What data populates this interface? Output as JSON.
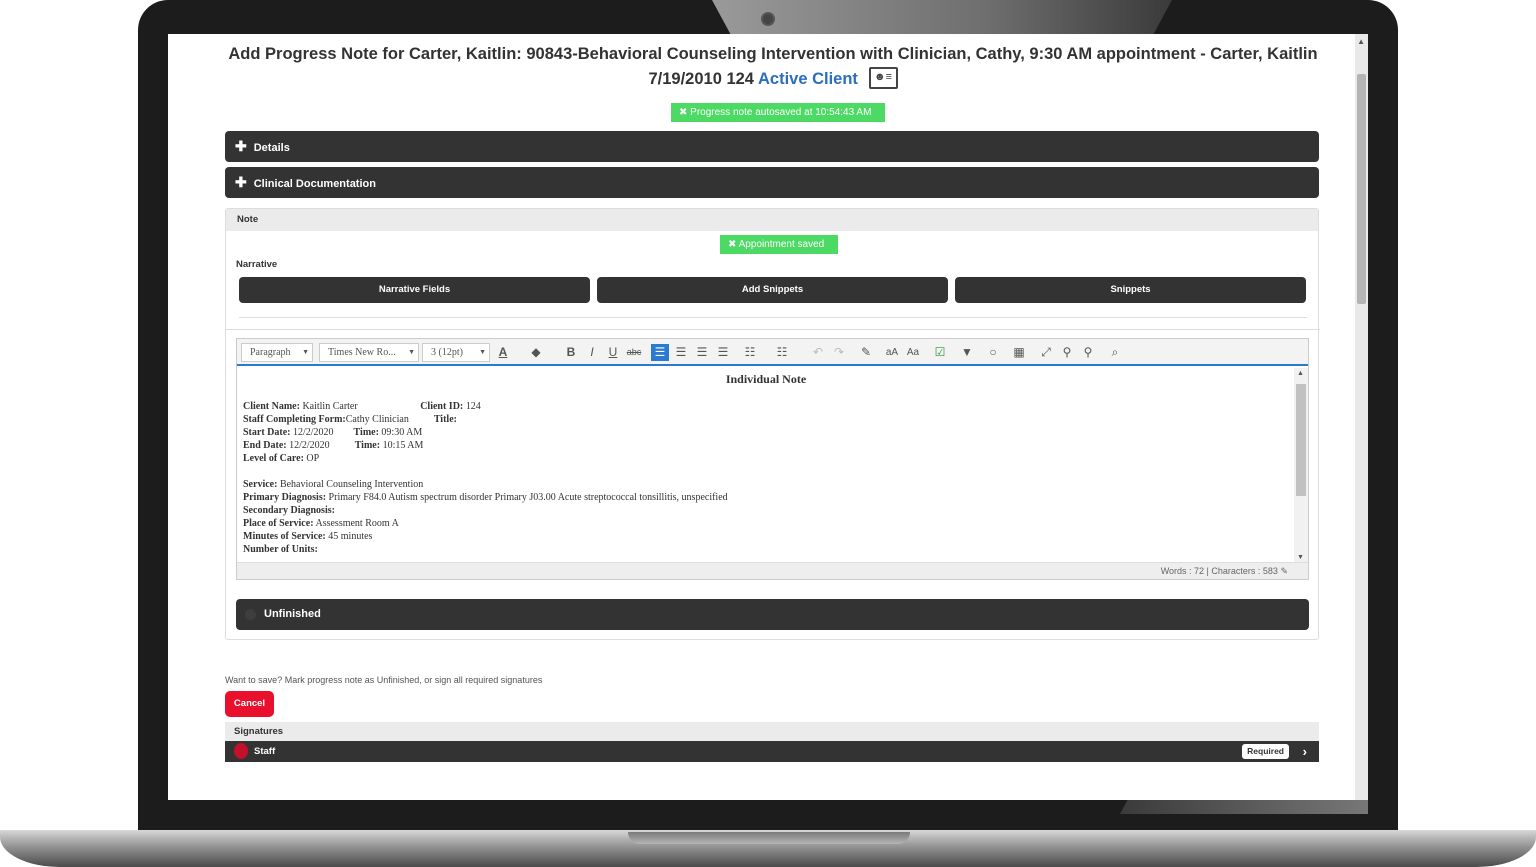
{
  "header": {
    "line1": "Add Progress Note for Carter, Kaitlin: 90843-Behavioral Counseling Intervention with Clinician, Cathy, 9:30 AM appointment - Carter, Kaitlin",
    "line2_prefix": "7/19/2010 124",
    "status": "Active Client",
    "status_color": "#2a6ebd",
    "card_icon": "id-card-icon"
  },
  "toasts": {
    "autosave": "Progress note autosaved at 10:54:43 AM",
    "appointment": "Appointment saved",
    "color": "#4cd964"
  },
  "panels": {
    "details": "Details",
    "clinical": "Clinical Documentation"
  },
  "note": {
    "section_title": "Note",
    "narrative_label": "Narrative",
    "buttons": [
      "Narrative Fields",
      "Add Snippets",
      "Snippets"
    ]
  },
  "toolbar": {
    "format": "Paragraph",
    "font": "Times New Ro...",
    "size": "3 (12pt)"
  },
  "document": {
    "heading": "Individual Note",
    "client_name_label": "Client Name:",
    "client_name": "Kaitlin Carter",
    "client_id_label": "Client ID:",
    "client_id": "124",
    "staff_label": "Staff Completing Form:",
    "staff": "Cathy Clinician",
    "title_label": "Title:",
    "start_date_label": "Start Date:",
    "start_date": "12/2/2020",
    "start_time_label": "Time:",
    "start_time": "09:30 AM",
    "end_date_label": "End Date:",
    "end_date": "12/2/2020",
    "end_time_label": "Time:",
    "end_time": "10:15 AM",
    "level_label": "Level of Care:",
    "level": "OP",
    "service_label": "Service:",
    "service": "Behavioral Counseling Intervention",
    "primary_dx_label": "Primary Diagnosis:",
    "primary_dx": "Primary F84.0 Autism spectrum disorder Primary J03.00 Acute streptococcal tonsillitis, unspecified",
    "secondary_dx_label": "Secondary Diagnosis:",
    "place_label": "Place of Service:",
    "place": "Assessment Room A",
    "minutes_label": "Minutes of Service:",
    "minutes": "45 minutes",
    "units_label": "Number of Units:"
  },
  "status_bar": {
    "words": "Words : 72",
    "characters": "Characters : 583"
  },
  "unfinished_label": "Unfinished",
  "footer": {
    "save_hint": "Want to save? Mark progress note as Unfinished, or sign all required signatures",
    "cancel": "Cancel",
    "cancel_color": "#e8102c",
    "signatures_title": "Signatures",
    "staff_label": "Staff",
    "required_badge": "Required"
  }
}
